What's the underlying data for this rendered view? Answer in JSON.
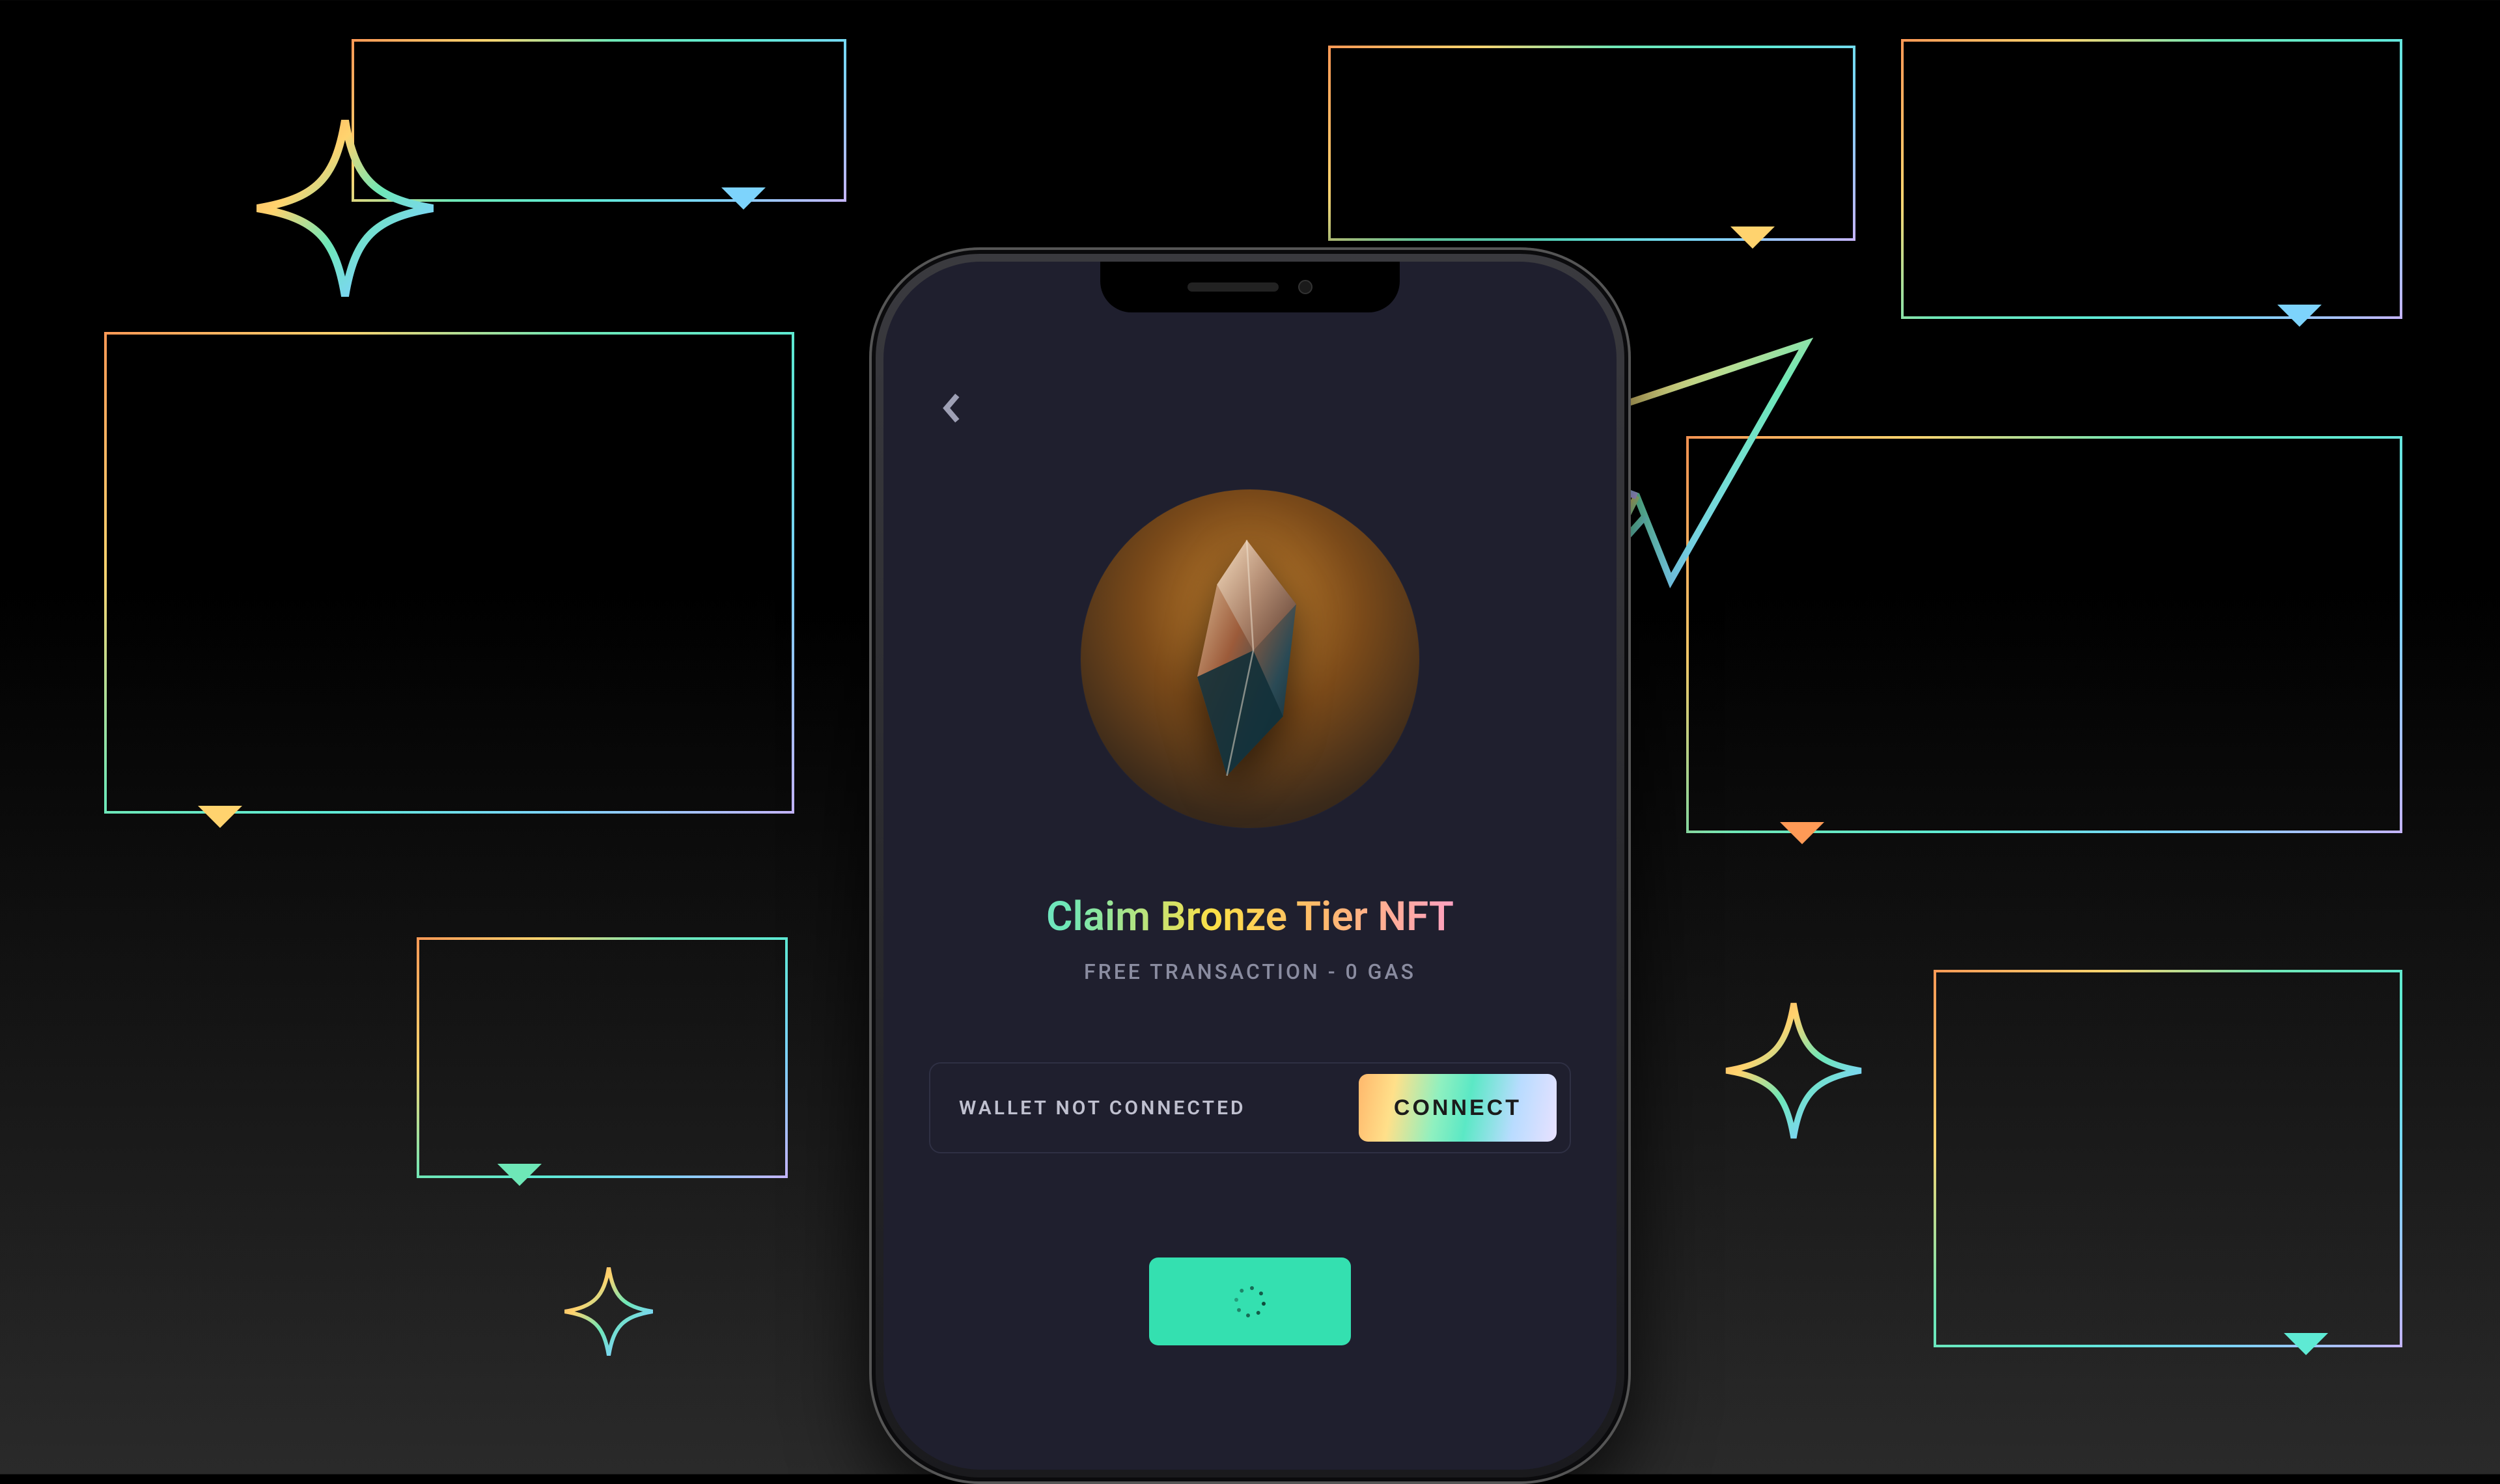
{
  "app": {
    "title": "Claim Bronze Tier NFT",
    "subtitle": "FREE TRANSACTION - 0 GAS"
  },
  "wallet": {
    "status": "WALLET NOT CONNECTED",
    "connect_label": "CONNECT"
  },
  "nft": {
    "tier": "Bronze",
    "artwork_name": "bronze-crystal"
  },
  "icons": {
    "back": "chevron-left",
    "sparkle": "sparkle",
    "paper_plane": "paper-plane",
    "speech_bubble": "speech-bubble"
  },
  "colors": {
    "accent_gradient": [
      "#ff9a56",
      "#ffd36e",
      "#6ee7b7",
      "#5eead4",
      "#7dd3fc",
      "#c4b5fd"
    ],
    "action_button": "#34e0b0",
    "screen_bg": "#1f1f2e"
  }
}
